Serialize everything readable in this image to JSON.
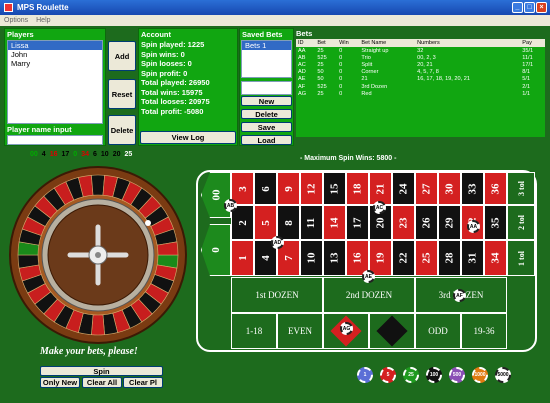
{
  "window": {
    "title": "MPS Roulette"
  },
  "menu": [
    "Options",
    "Help"
  ],
  "players": {
    "header": "Players",
    "items": [
      "Lissa",
      "John",
      "Marry"
    ],
    "selected": "Lissa",
    "input_label": "Player name input",
    "input_value": ""
  },
  "player_buttons": {
    "add": "Add",
    "reset": "Reset",
    "delete": "Delete"
  },
  "account": {
    "header": "Account",
    "lines": [
      "Spin played: 1225",
      "Spin wins: 0",
      "Spin looses: 0",
      "Spin profit: 0",
      "Total played: 26950",
      "Total wins: 15975",
      "Total looses: 20975",
      "Total profit: -5080"
    ],
    "view_log": "View Log"
  },
  "saved_bets": {
    "header": "Saved Bets",
    "items": [
      "Bets 1"
    ],
    "new": "New",
    "delete": "Delete",
    "save": "Save",
    "load": "Load"
  },
  "bets": {
    "header": "Bets",
    "columns": [
      "ID",
      "Bet",
      "Win",
      "Bet Name",
      "Numbers",
      "Pay"
    ],
    "rows": [
      [
        "AA",
        "25",
        "0",
        "Straight up",
        "32",
        "35/1"
      ],
      [
        "AB",
        "525",
        "0",
        "Trio",
        "00, 2, 3",
        "11/1"
      ],
      [
        "AC",
        "25",
        "0",
        "Split",
        "20, 21",
        "17/1"
      ],
      [
        "AD",
        "50",
        "0",
        "Corner",
        "4, 5, 7, 8",
        "8/1"
      ],
      [
        "AE",
        "50",
        "0",
        "21",
        "16, 17, 18, 19, 20, 21",
        "5/1"
      ],
      [
        "AF",
        "525",
        "0",
        "3rd Dozen",
        "",
        "2/1"
      ],
      [
        "AG",
        "25",
        "0",
        "Red",
        "",
        "1/1"
      ]
    ]
  },
  "history": [
    {
      "n": "00",
      "c": "#00aa00"
    },
    {
      "n": "4",
      "c": "#000"
    },
    {
      "n": "16",
      "c": "#d00"
    },
    {
      "n": "17",
      "c": "#000"
    },
    {
      "n": "0",
      "c": "#00aa00"
    },
    {
      "n": "34",
      "c": "#d00"
    },
    {
      "n": "6",
      "c": "#000"
    },
    {
      "n": "10",
      "c": "#000"
    },
    {
      "n": "20",
      "c": "#000"
    },
    {
      "n": "25",
      "c": "#fff"
    }
  ],
  "max_spin": "- Maximum Spin Wins: 5800 -",
  "zeros": [
    "00",
    "0"
  ],
  "rows_top": [
    {
      "n": "3",
      "c": "red"
    },
    {
      "n": "6",
      "c": "blk"
    },
    {
      "n": "9",
      "c": "red"
    },
    {
      "n": "12",
      "c": "red"
    },
    {
      "n": "15",
      "c": "blk"
    },
    {
      "n": "18",
      "c": "red"
    },
    {
      "n": "21",
      "c": "red"
    },
    {
      "n": "24",
      "c": "blk"
    },
    {
      "n": "27",
      "c": "red"
    },
    {
      "n": "30",
      "c": "red"
    },
    {
      "n": "33",
      "c": "blk"
    },
    {
      "n": "36",
      "c": "red"
    }
  ],
  "rows_mid": [
    {
      "n": "2",
      "c": "blk"
    },
    {
      "n": "5",
      "c": "red"
    },
    {
      "n": "8",
      "c": "blk"
    },
    {
      "n": "11",
      "c": "blk"
    },
    {
      "n": "14",
      "c": "red"
    },
    {
      "n": "17",
      "c": "blk"
    },
    {
      "n": "20",
      "c": "blk"
    },
    {
      "n": "23",
      "c": "red"
    },
    {
      "n": "26",
      "c": "blk"
    },
    {
      "n": "29",
      "c": "blk"
    },
    {
      "n": "32",
      "c": "red"
    },
    {
      "n": "35",
      "c": "blk"
    }
  ],
  "rows_bot": [
    {
      "n": "1",
      "c": "red"
    },
    {
      "n": "4",
      "c": "blk"
    },
    {
      "n": "7",
      "c": "red"
    },
    {
      "n": "10",
      "c": "blk"
    },
    {
      "n": "13",
      "c": "blk"
    },
    {
      "n": "16",
      "c": "red"
    },
    {
      "n": "19",
      "c": "red"
    },
    {
      "n": "22",
      "c": "blk"
    },
    {
      "n": "25",
      "c": "red"
    },
    {
      "n": "28",
      "c": "blk"
    },
    {
      "n": "31",
      "c": "blk"
    },
    {
      "n": "34",
      "c": "red"
    }
  ],
  "columns_labels": [
    "3 tol",
    "2 tol",
    "1 tol"
  ],
  "dozens": [
    "1st DOZEN",
    "2nd DOZEN",
    "3rd DOZEN"
  ],
  "outside": [
    "1-18",
    "EVEN",
    "",
    "",
    "ODD",
    "19-36"
  ],
  "placed_chips": [
    "AB",
    "AD",
    "AC",
    "AE",
    "AA",
    "AF",
    "AG"
  ],
  "chips": [
    {
      "v": "1",
      "c": "#5b6fd6"
    },
    {
      "v": "5",
      "c": "#d42020"
    },
    {
      "v": "25",
      "c": "#1f9a1f"
    },
    {
      "v": "100",
      "c": "#111"
    },
    {
      "v": "500",
      "c": "#8a4fb5"
    },
    {
      "v": "1000",
      "c": "#e07a10"
    },
    {
      "v": "5000",
      "c": "#fff"
    }
  ],
  "prompt": "Make your bets, please!",
  "spin": {
    "spin": "Spin",
    "only_new": "Only New",
    "clear_all": "Clear All",
    "clear_pl": "Clear Pl"
  }
}
